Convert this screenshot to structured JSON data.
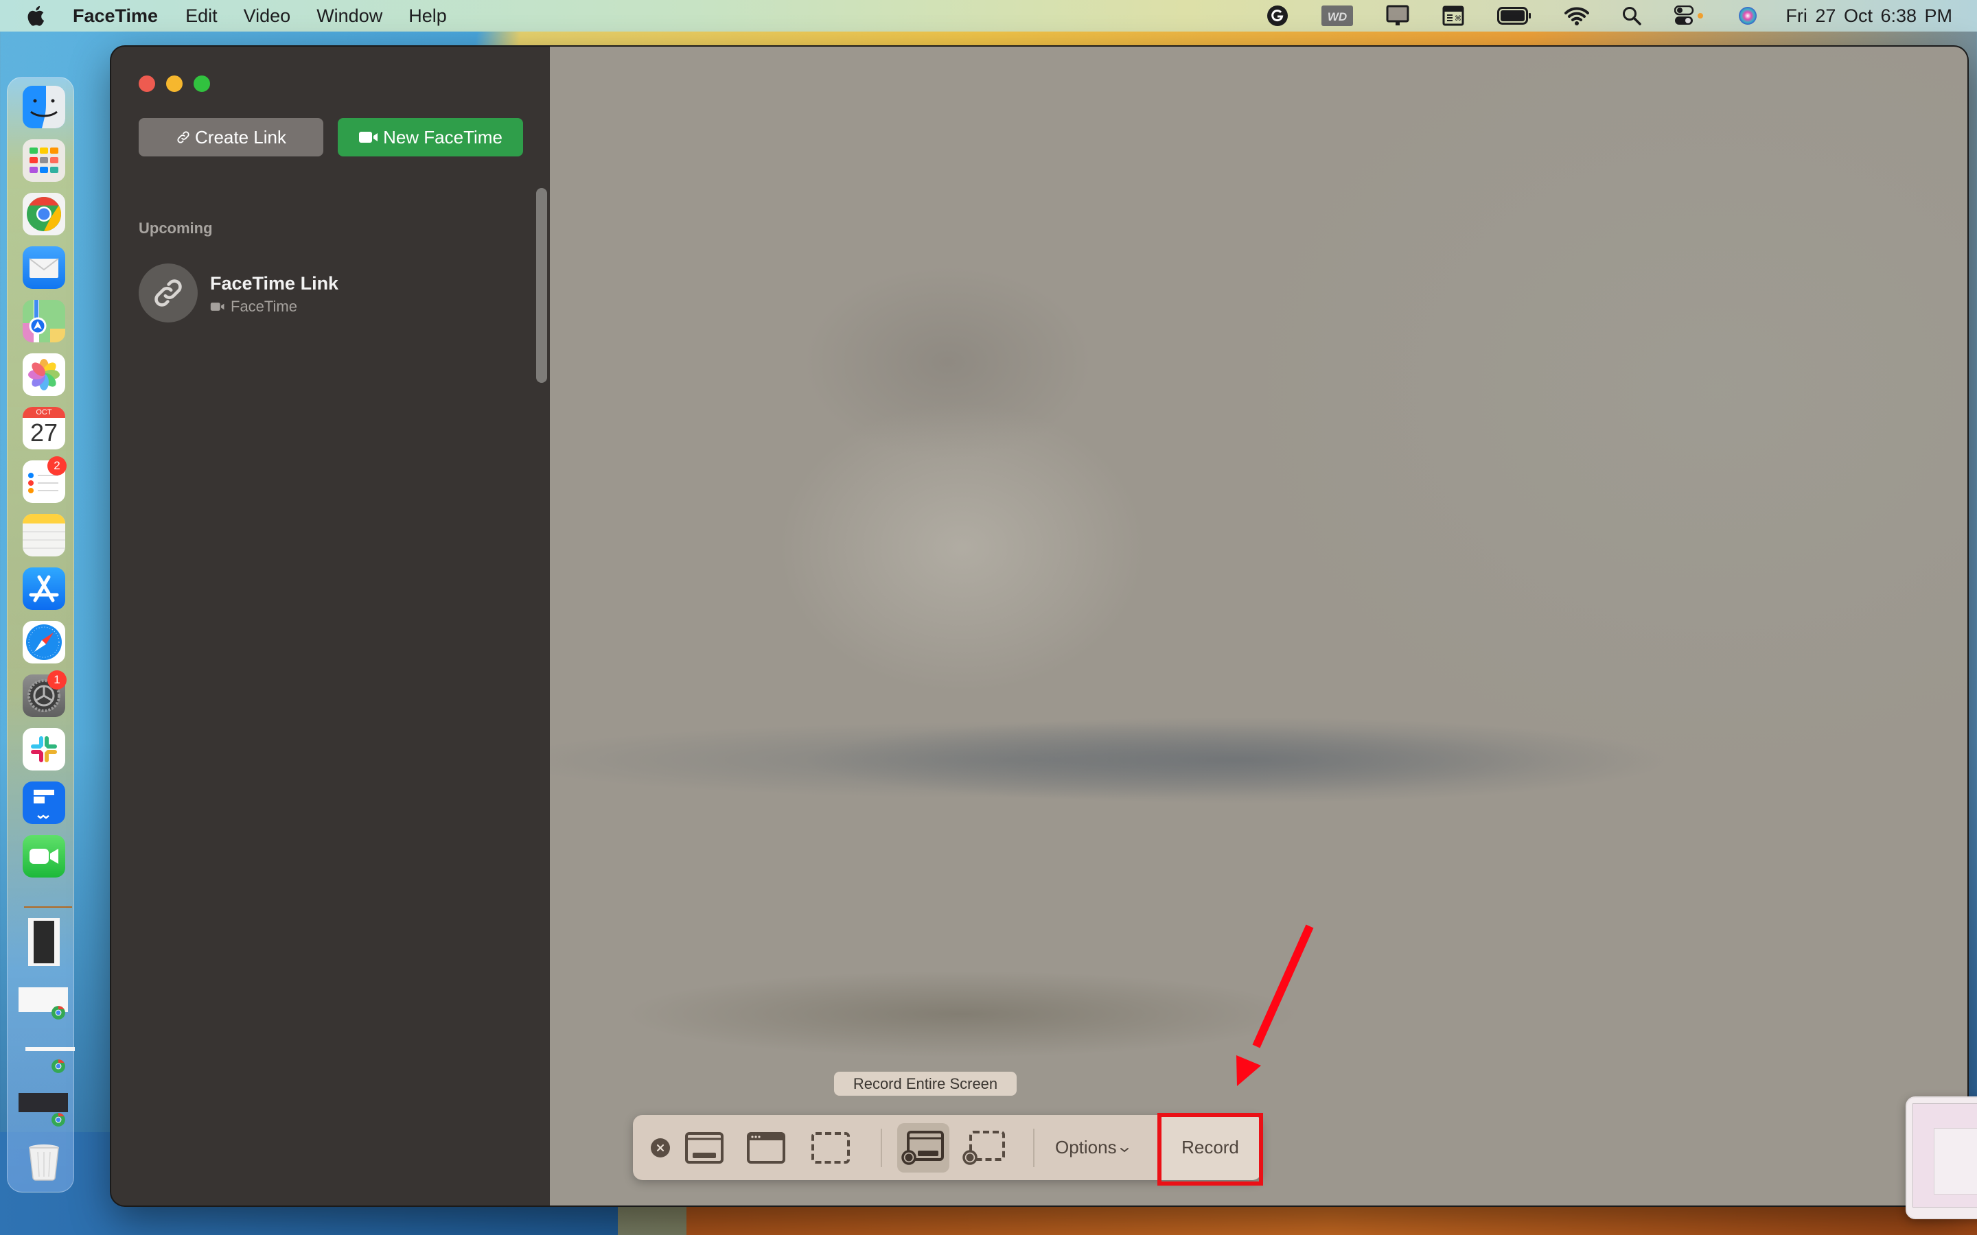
{
  "menubar": {
    "app_name": "FaceTime",
    "items": [
      "Edit",
      "Video",
      "Window",
      "Help"
    ],
    "status_icons": [
      "grammarly-icon",
      "wd-drive-icon",
      "display-icon",
      "keyboard-viewer-icon",
      "battery-icon",
      "wifi-icon",
      "spotlight-search-icon",
      "control-center-icon",
      "siri-icon"
    ],
    "clock": "Fri 27 Oct  6:38 PM"
  },
  "dock": {
    "apps": [
      {
        "name": "Finder",
        "icon": "finder-icon"
      },
      {
        "name": "Launchpad",
        "icon": "launchpad-icon"
      },
      {
        "name": "Google Chrome",
        "icon": "chrome-icon"
      },
      {
        "name": "Mail",
        "icon": "mail-icon"
      },
      {
        "name": "Maps",
        "icon": "maps-icon"
      },
      {
        "name": "Photos",
        "icon": "photos-icon"
      },
      {
        "name": "Calendar",
        "icon": "calendar-icon",
        "month": "OCT",
        "day": "27"
      },
      {
        "name": "Reminders",
        "icon": "reminders-icon",
        "badge": "2"
      },
      {
        "name": "Notes",
        "icon": "notes-icon"
      },
      {
        "name": "App Store",
        "icon": "app-store-icon"
      },
      {
        "name": "Safari",
        "icon": "safari-icon"
      },
      {
        "name": "System Settings",
        "icon": "system-settings-icon",
        "badge": "1"
      },
      {
        "name": "Slack",
        "icon": "slack-icon"
      },
      {
        "name": "Wondershare",
        "icon": "wondershare-icon"
      },
      {
        "name": "FaceTime",
        "icon": "facetime-icon"
      }
    ],
    "recent": [
      "downloads-stack",
      "chrome-window-1",
      "chrome-window-2",
      "chrome-window-3",
      "trash"
    ]
  },
  "window": {
    "sidebar": {
      "create_link_label": "Create Link",
      "new_facetime_label": "New FaceTime",
      "section_label": "Upcoming",
      "items": [
        {
          "title": "FaceTime Link",
          "subtitle": "FaceTime"
        }
      ]
    }
  },
  "screenshot_toolbar": {
    "tooltip": "Record Entire Screen",
    "buttons": [
      {
        "name": "capture-entire-screen",
        "selected": false
      },
      {
        "name": "capture-selected-window",
        "selected": false
      },
      {
        "name": "capture-selected-portion",
        "selected": false
      },
      {
        "name": "record-entire-screen",
        "selected": true
      },
      {
        "name": "record-selected-portion",
        "selected": false
      }
    ],
    "options_label": "Options",
    "record_label": "Record"
  },
  "annotation": {
    "color": "#ea1016",
    "target": "Record"
  },
  "colors": {
    "green_button": "#2f9e4a",
    "sidebar_bg": "#383432",
    "highlight": "#ea1016"
  }
}
